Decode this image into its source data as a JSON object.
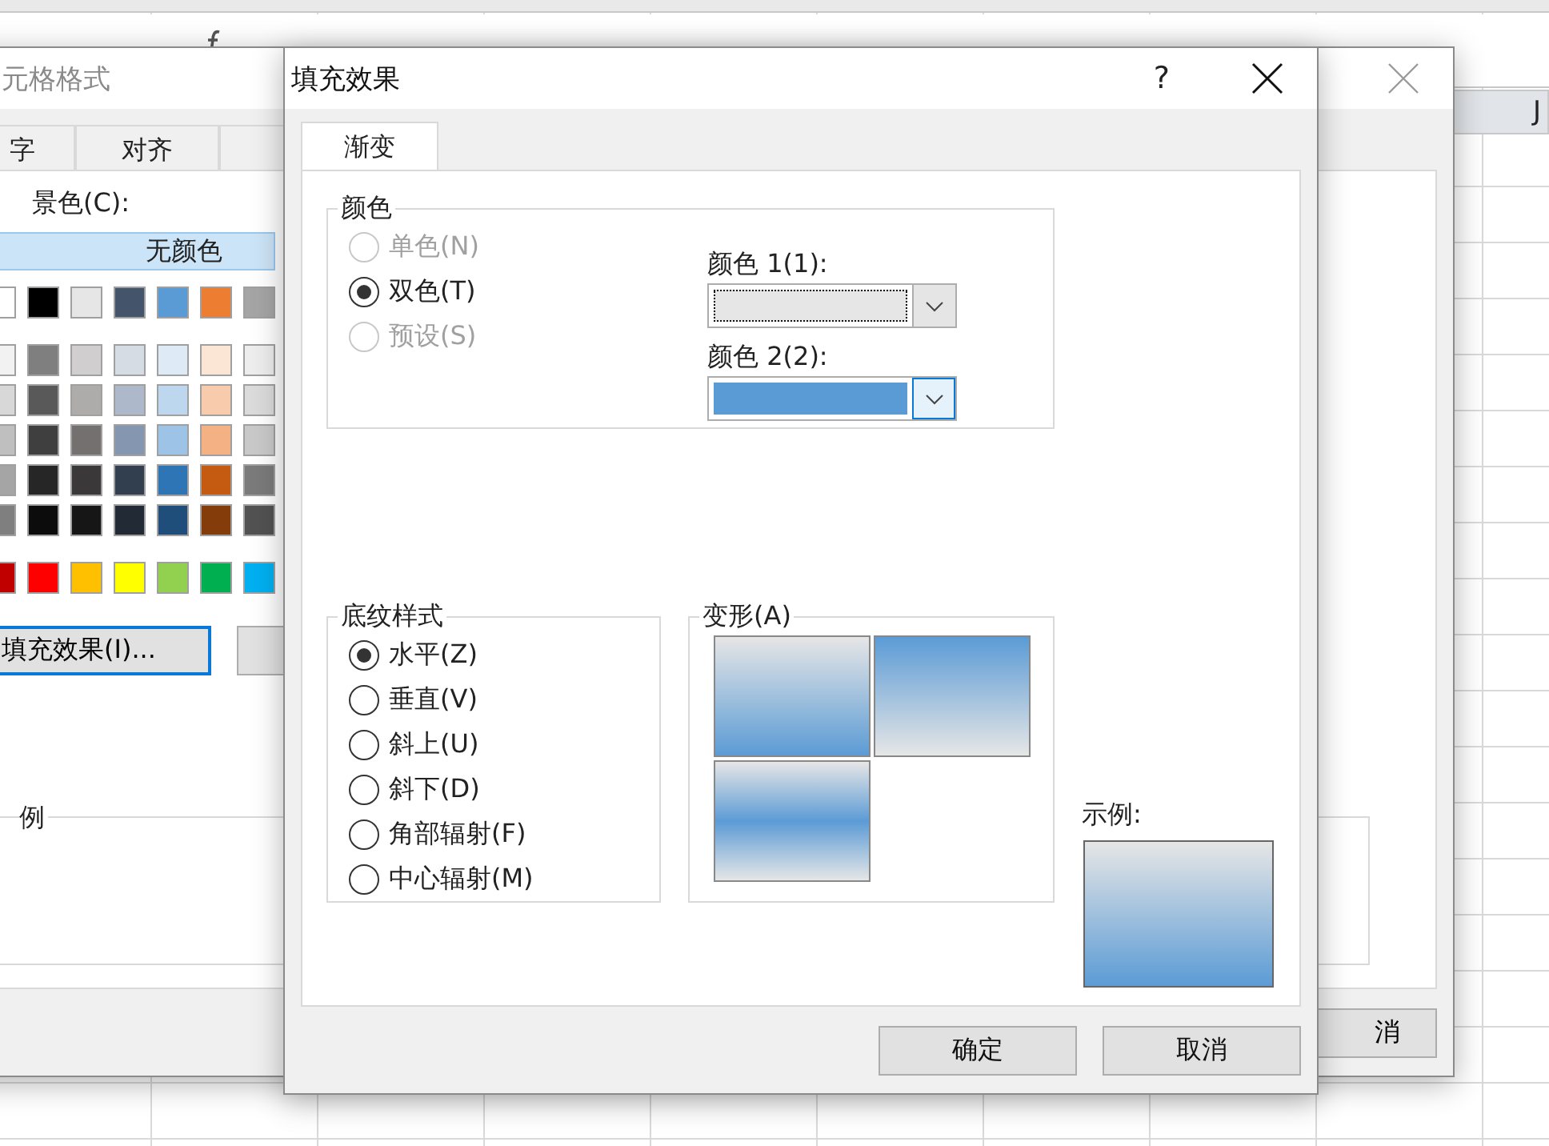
{
  "spreadsheet": {
    "column_header": "J"
  },
  "format_dialog": {
    "title": "元格格式",
    "tabs": [
      {
        "label": "字",
        "selected": false
      },
      {
        "label": "对齐",
        "selected": false
      },
      {
        "selected": false
      }
    ],
    "background_label": "景色(C):",
    "no_color": "无颜色",
    "swatch_rows": [
      {
        "swatches": [
          {
            "color": "#ffffff"
          },
          {
            "color": "#000000"
          },
          {
            "color": "#e7e6e6"
          },
          {
            "color": "#44546a"
          },
          {
            "color": "#5b9bd5"
          },
          {
            "color": "#ed7d31"
          },
          {
            "color": "#a5a5a5"
          }
        ]
      },
      {
        "swatches": [
          {
            "color": "#f2f2f2"
          },
          {
            "color": "#7f7f7f"
          },
          {
            "color": "#d0cece"
          },
          {
            "color": "#d6dce4"
          },
          {
            "color": "#deebf6"
          },
          {
            "color": "#fbe5d5"
          },
          {
            "color": "#ededed"
          }
        ]
      },
      {
        "swatches": [
          {
            "color": "#d8d8d8"
          },
          {
            "color": "#595959"
          },
          {
            "color": "#aeabab"
          },
          {
            "color": "#adb9ca"
          },
          {
            "color": "#bdd7ee"
          },
          {
            "color": "#f7cbac"
          },
          {
            "color": "#dbdbdb"
          }
        ]
      },
      {
        "swatches": [
          {
            "color": "#bfbfbf"
          },
          {
            "color": "#3f3f3f"
          },
          {
            "color": "#757070"
          },
          {
            "color": "#8496b0"
          },
          {
            "color": "#9dc3e6"
          },
          {
            "color": "#f4b183"
          },
          {
            "color": "#c9c9c9"
          }
        ]
      },
      {
        "swatches": [
          {
            "color": "#a5a5a5"
          },
          {
            "color": "#262626"
          },
          {
            "color": "#3a3838"
          },
          {
            "color": "#323f4f"
          },
          {
            "color": "#2e75b5"
          },
          {
            "color": "#c55a11"
          },
          {
            "color": "#7b7b7b"
          }
        ]
      },
      {
        "swatches": [
          {
            "color": "#7f7f7f"
          },
          {
            "color": "#0c0c0c"
          },
          {
            "color": "#171616"
          },
          {
            "color": "#222a35"
          },
          {
            "color": "#1e4e79"
          },
          {
            "color": "#843c0b"
          },
          {
            "color": "#525252"
          }
        ]
      },
      {
        "swatches": [
          {
            "color": "#c00000"
          },
          {
            "color": "#ff0000"
          },
          {
            "color": "#ffc000"
          },
          {
            "color": "#ffff00"
          },
          {
            "color": "#92d050"
          },
          {
            "color": "#00b050"
          },
          {
            "color": "#00b0f0"
          }
        ]
      }
    ],
    "fill_effects_button": "填充效果(I)...",
    "sample_label": "例",
    "cancel_fragment": "消"
  },
  "fill_dialog": {
    "title": "填充效果",
    "help": "?",
    "tabs": [
      {
        "label": "渐变",
        "selected": true
      }
    ],
    "colors_group": {
      "title": "颜色",
      "options": [
        {
          "label": "单色(N)",
          "selected": false,
          "disabled": true
        },
        {
          "label": "双色(T)",
          "selected": true,
          "disabled": false
        },
        {
          "label": "预设(S)",
          "selected": false,
          "disabled": true
        }
      ],
      "pickers": [
        {
          "label": "颜色 1(1):",
          "color": "#e6e6e6",
          "focused": true
        },
        {
          "label": "颜色 2(2):",
          "color": "#5b9bd5",
          "focused": false
        }
      ]
    },
    "shading_group": {
      "title": "底纹样式",
      "options": [
        {
          "label": "水平(Z)",
          "selected": true
        },
        {
          "label": "垂直(V)",
          "selected": false
        },
        {
          "label": "斜上(U)",
          "selected": false
        },
        {
          "label": "斜下(D)",
          "selected": false
        },
        {
          "label": "角部辐射(F)",
          "selected": false
        },
        {
          "label": "中心辐射(M)",
          "selected": false
        }
      ]
    },
    "variants_group": {
      "title": "变形(A)",
      "variants": [
        {
          "kind": "down"
        },
        {
          "kind": "up"
        },
        {
          "kind": "center"
        }
      ]
    },
    "sample_label": "示例:",
    "buttons": [
      "确定",
      "取消"
    ]
  }
}
